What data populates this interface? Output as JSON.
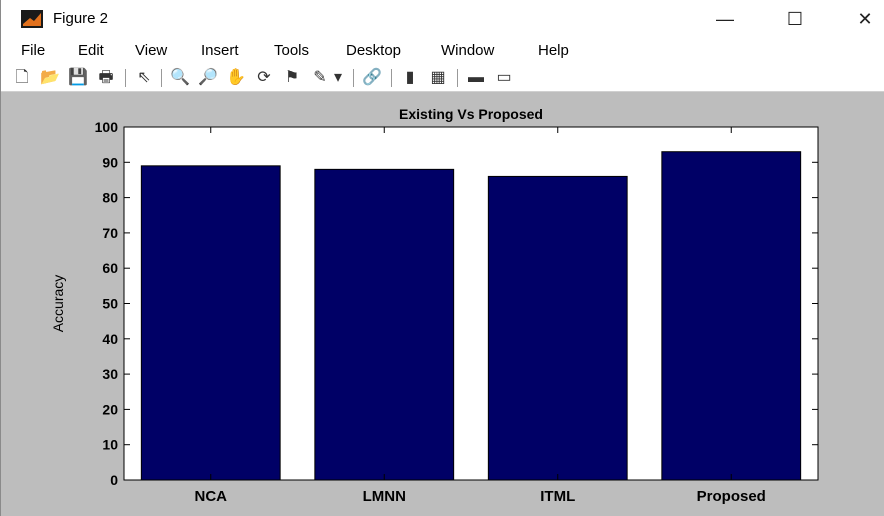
{
  "window": {
    "title": "Figure 2",
    "minimize": "—",
    "maximize": "☐",
    "close": "✕"
  },
  "menu": [
    "File",
    "Edit",
    "View",
    "Insert",
    "Tools",
    "Desktop",
    "Window",
    "Help"
  ],
  "toolbar": {
    "icons": [
      "new-figure-icon",
      "open-file-icon",
      "save-icon",
      "print-icon",
      "pointer-icon",
      "zoom-in-icon",
      "zoom-out-icon",
      "pan-icon",
      "rotate-icon",
      "data-cursor-icon",
      "brush-icon",
      "dropdown-arrow-icon",
      "link-plot-icon",
      "colorbar-icon",
      "legend-icon",
      "hide-plot-tools-icon",
      "show-plot-tools-icon"
    ],
    "glyphs": [
      "🗋",
      "📂",
      "💾",
      "🖶",
      "⇖",
      "🔍",
      "🔎",
      "✋",
      "⟳",
      "⚑",
      "✎",
      "▾",
      "🔗",
      "▮",
      "▦",
      "▬",
      "▭"
    ]
  },
  "colors": {
    "bar": "#000066",
    "figure_bg": "#bdbdbd",
    "axes_bg": "#ffffff"
  },
  "chart_data": {
    "type": "bar",
    "title": "Existing Vs Proposed",
    "xlabel": "",
    "ylabel": "Accuracy",
    "categories": [
      "NCA",
      "LMNN",
      "ITML",
      "Proposed"
    ],
    "values": [
      89,
      88,
      86,
      93
    ],
    "ylim": [
      0,
      100
    ],
    "yticks": [
      0,
      10,
      20,
      30,
      40,
      50,
      60,
      70,
      80,
      90,
      100
    ],
    "grid": false,
    "legend": "none"
  }
}
